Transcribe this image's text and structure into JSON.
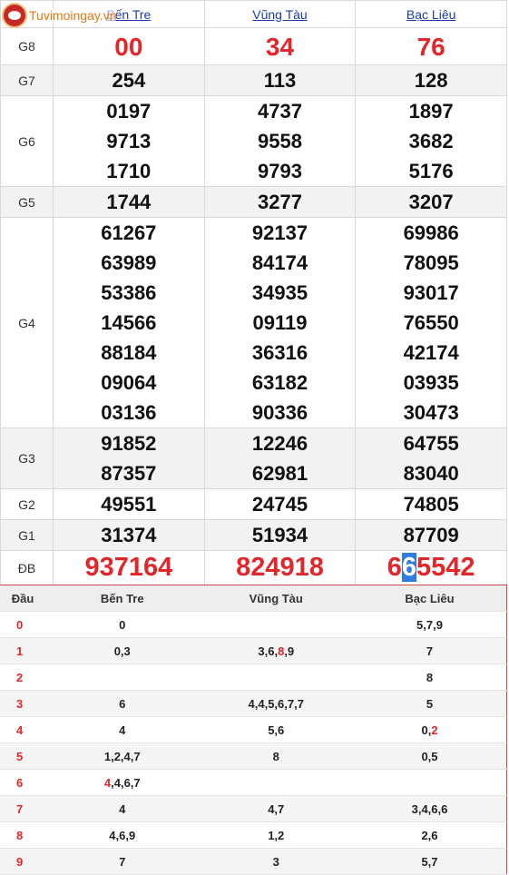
{
  "logo": {
    "text": "Tuvimoingay.vn"
  },
  "provinces": [
    "Bến Tre",
    "Vũng Tàu",
    "Bạc Liêu"
  ],
  "prizes": [
    {
      "label": "G8",
      "values": [
        [
          "00"
        ],
        [
          "34"
        ],
        [
          "76"
        ]
      ]
    },
    {
      "label": "G7",
      "values": [
        [
          "254"
        ],
        [
          "113"
        ],
        [
          "128"
        ]
      ]
    },
    {
      "label": "G6",
      "values": [
        [
          "0197",
          "9713",
          "1710"
        ],
        [
          "4737",
          "9558",
          "9793"
        ],
        [
          "1897",
          "3682",
          "5176"
        ]
      ]
    },
    {
      "label": "G5",
      "values": [
        [
          "1744"
        ],
        [
          "3277"
        ],
        [
          "3207"
        ]
      ]
    },
    {
      "label": "G4",
      "values": [
        [
          "61267",
          "63989",
          "53386",
          "14566",
          "88184",
          "09064",
          "03136"
        ],
        [
          "92137",
          "84174",
          "34935",
          "09119",
          "36316",
          "63182",
          "90336"
        ],
        [
          "69986",
          "78095",
          "93017",
          "76550",
          "42174",
          "03935",
          "30473"
        ]
      ]
    },
    {
      "label": "G3",
      "values": [
        [
          "91852",
          "87357"
        ],
        [
          "12246",
          "62981"
        ],
        [
          "64755",
          "83040"
        ]
      ]
    },
    {
      "label": "G2",
      "values": [
        [
          "49551"
        ],
        [
          "24745"
        ],
        [
          "74805"
        ]
      ]
    },
    {
      "label": "G1",
      "values": [
        [
          "31374"
        ],
        [
          "51934"
        ],
        [
          "87709"
        ]
      ]
    },
    {
      "label": "ĐB",
      "values": [
        [
          "937164"
        ],
        [
          "824918"
        ],
        [
          "665542"
        ]
      ]
    }
  ],
  "special_highlight": {
    "column": 2,
    "digit_index": 1
  },
  "head_table": {
    "header": [
      "Đầu",
      "Bến Tre",
      "Vũng Tàu",
      "Bạc Liêu"
    ],
    "rows": [
      {
        "head": "0",
        "cells": [
          "0",
          "",
          "5,7,9"
        ]
      },
      {
        "head": "1",
        "cells": [
          "0,3",
          "3,6,8,9",
          "7"
        ]
      },
      {
        "head": "2",
        "cells": [
          "",
          "",
          "8"
        ]
      },
      {
        "head": "3",
        "cells": [
          "6",
          "4,4,5,6,7,7",
          "5"
        ]
      },
      {
        "head": "4",
        "cells": [
          "4",
          "5,6",
          "0,2"
        ]
      },
      {
        "head": "5",
        "cells": [
          "1,2,4,7",
          "8",
          "0,5"
        ]
      },
      {
        "head": "6",
        "cells": [
          "4,4,6,7",
          "",
          ""
        ]
      },
      {
        "head": "7",
        "cells": [
          "4",
          "4,7",
          "3,4,6,6"
        ]
      },
      {
        "head": "8",
        "cells": [
          "4,6,9",
          "1,2",
          "2,6"
        ]
      },
      {
        "head": "9",
        "cells": [
          "7",
          "3",
          "5,7"
        ]
      }
    ],
    "red_marks": [
      {
        "row": 1,
        "col": 1,
        "item": 2
      },
      {
        "row": 4,
        "col": 2,
        "item": 1
      },
      {
        "row": 6,
        "col": 0,
        "item": 0
      }
    ]
  },
  "colors": {
    "red": "#e3262a",
    "link": "#1a3ea8",
    "highlight": "#2e7de1"
  }
}
